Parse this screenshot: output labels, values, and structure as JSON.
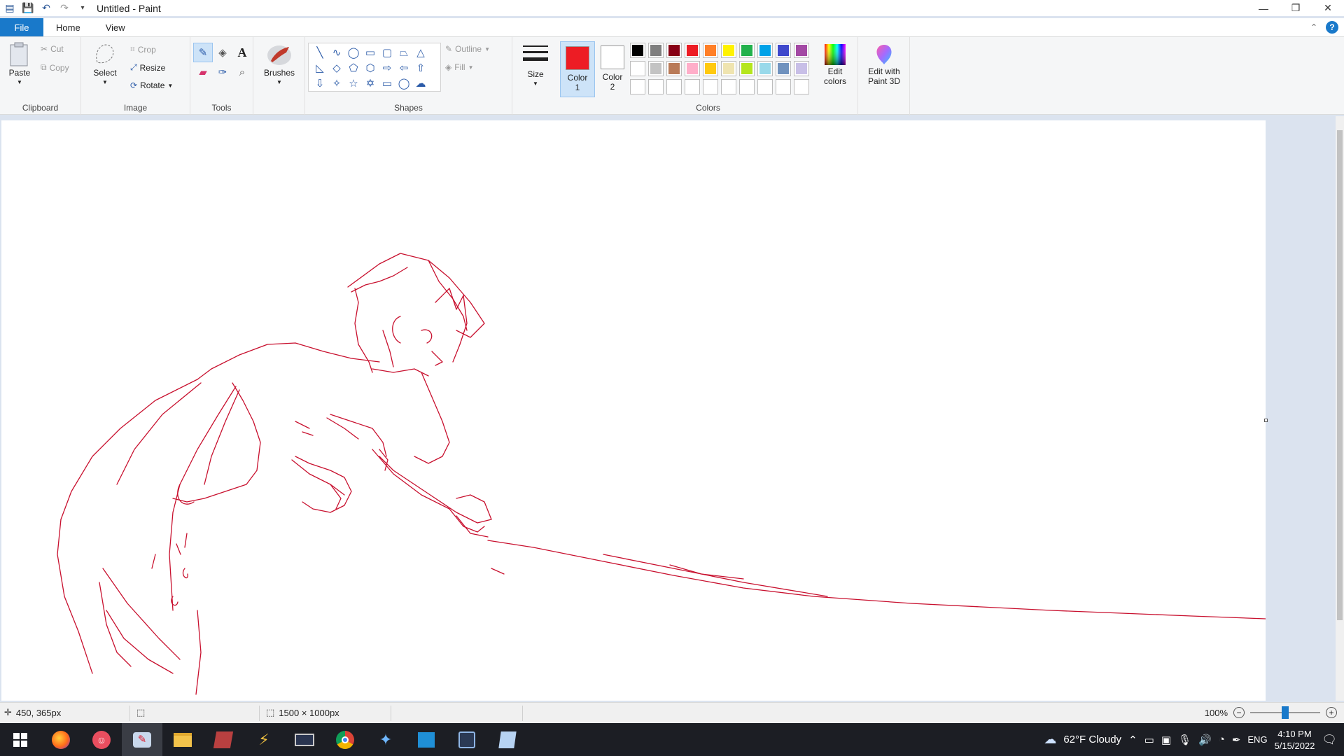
{
  "window": {
    "title": "Untitled - Paint"
  },
  "tabs": [
    {
      "label": "File"
    },
    {
      "label": "Home"
    },
    {
      "label": "View"
    }
  ],
  "ribbon": {
    "clipboard": {
      "paste": "Paste",
      "cut": "Cut",
      "copy": "Copy",
      "group_label": "Clipboard"
    },
    "image": {
      "select": "Select",
      "crop": "Crop",
      "resize": "Resize",
      "rotate": "Rotate",
      "group_label": "Image"
    },
    "tools": {
      "group_label": "Tools"
    },
    "brushes": {
      "label": "Brushes"
    },
    "shapes": {
      "outline": "Outline",
      "fill": "Fill",
      "group_label": "Shapes"
    },
    "size": {
      "label": "Size"
    },
    "colors": {
      "color1_line1": "Color",
      "color1_line2": "1",
      "color2_line1": "Color",
      "color2_line2": "2",
      "color1_value": "#ed1c24",
      "color2_value": "#ffffff",
      "edit_colors_line1": "Edit",
      "edit_colors_line2": "colors",
      "group_label": "Colors",
      "palette": [
        "#000000",
        "#7f7f7f",
        "#880015",
        "#ed1c24",
        "#ff7f27",
        "#fff200",
        "#22b14c",
        "#00a2e8",
        "#3f48cc",
        "#a349a4",
        "#ffffff",
        "#c3c3c3",
        "#b97a57",
        "#ffaec9",
        "#ffc90e",
        "#efe4b0",
        "#b5e61d",
        "#99d9ea",
        "#7092be",
        "#c8bfe7",
        "#ffffff",
        "#ffffff",
        "#ffffff",
        "#ffffff",
        "#ffffff",
        "#ffffff",
        "#ffffff",
        "#ffffff",
        "#ffffff",
        "#ffffff"
      ]
    },
    "paint3d": {
      "line1": "Edit with",
      "line2": "Paint 3D"
    }
  },
  "canvas": {
    "stroke_color": "#c8102e"
  },
  "status": {
    "cursor_pos": "450, 365px",
    "canvas_size": "1500 × 1000px",
    "zoom": "100%",
    "zoom_fraction": 0.5
  },
  "taskbar": {
    "weather": "62°F  Cloudy",
    "language": "ENG",
    "time": "4:10 PM",
    "date": "5/15/2022"
  }
}
